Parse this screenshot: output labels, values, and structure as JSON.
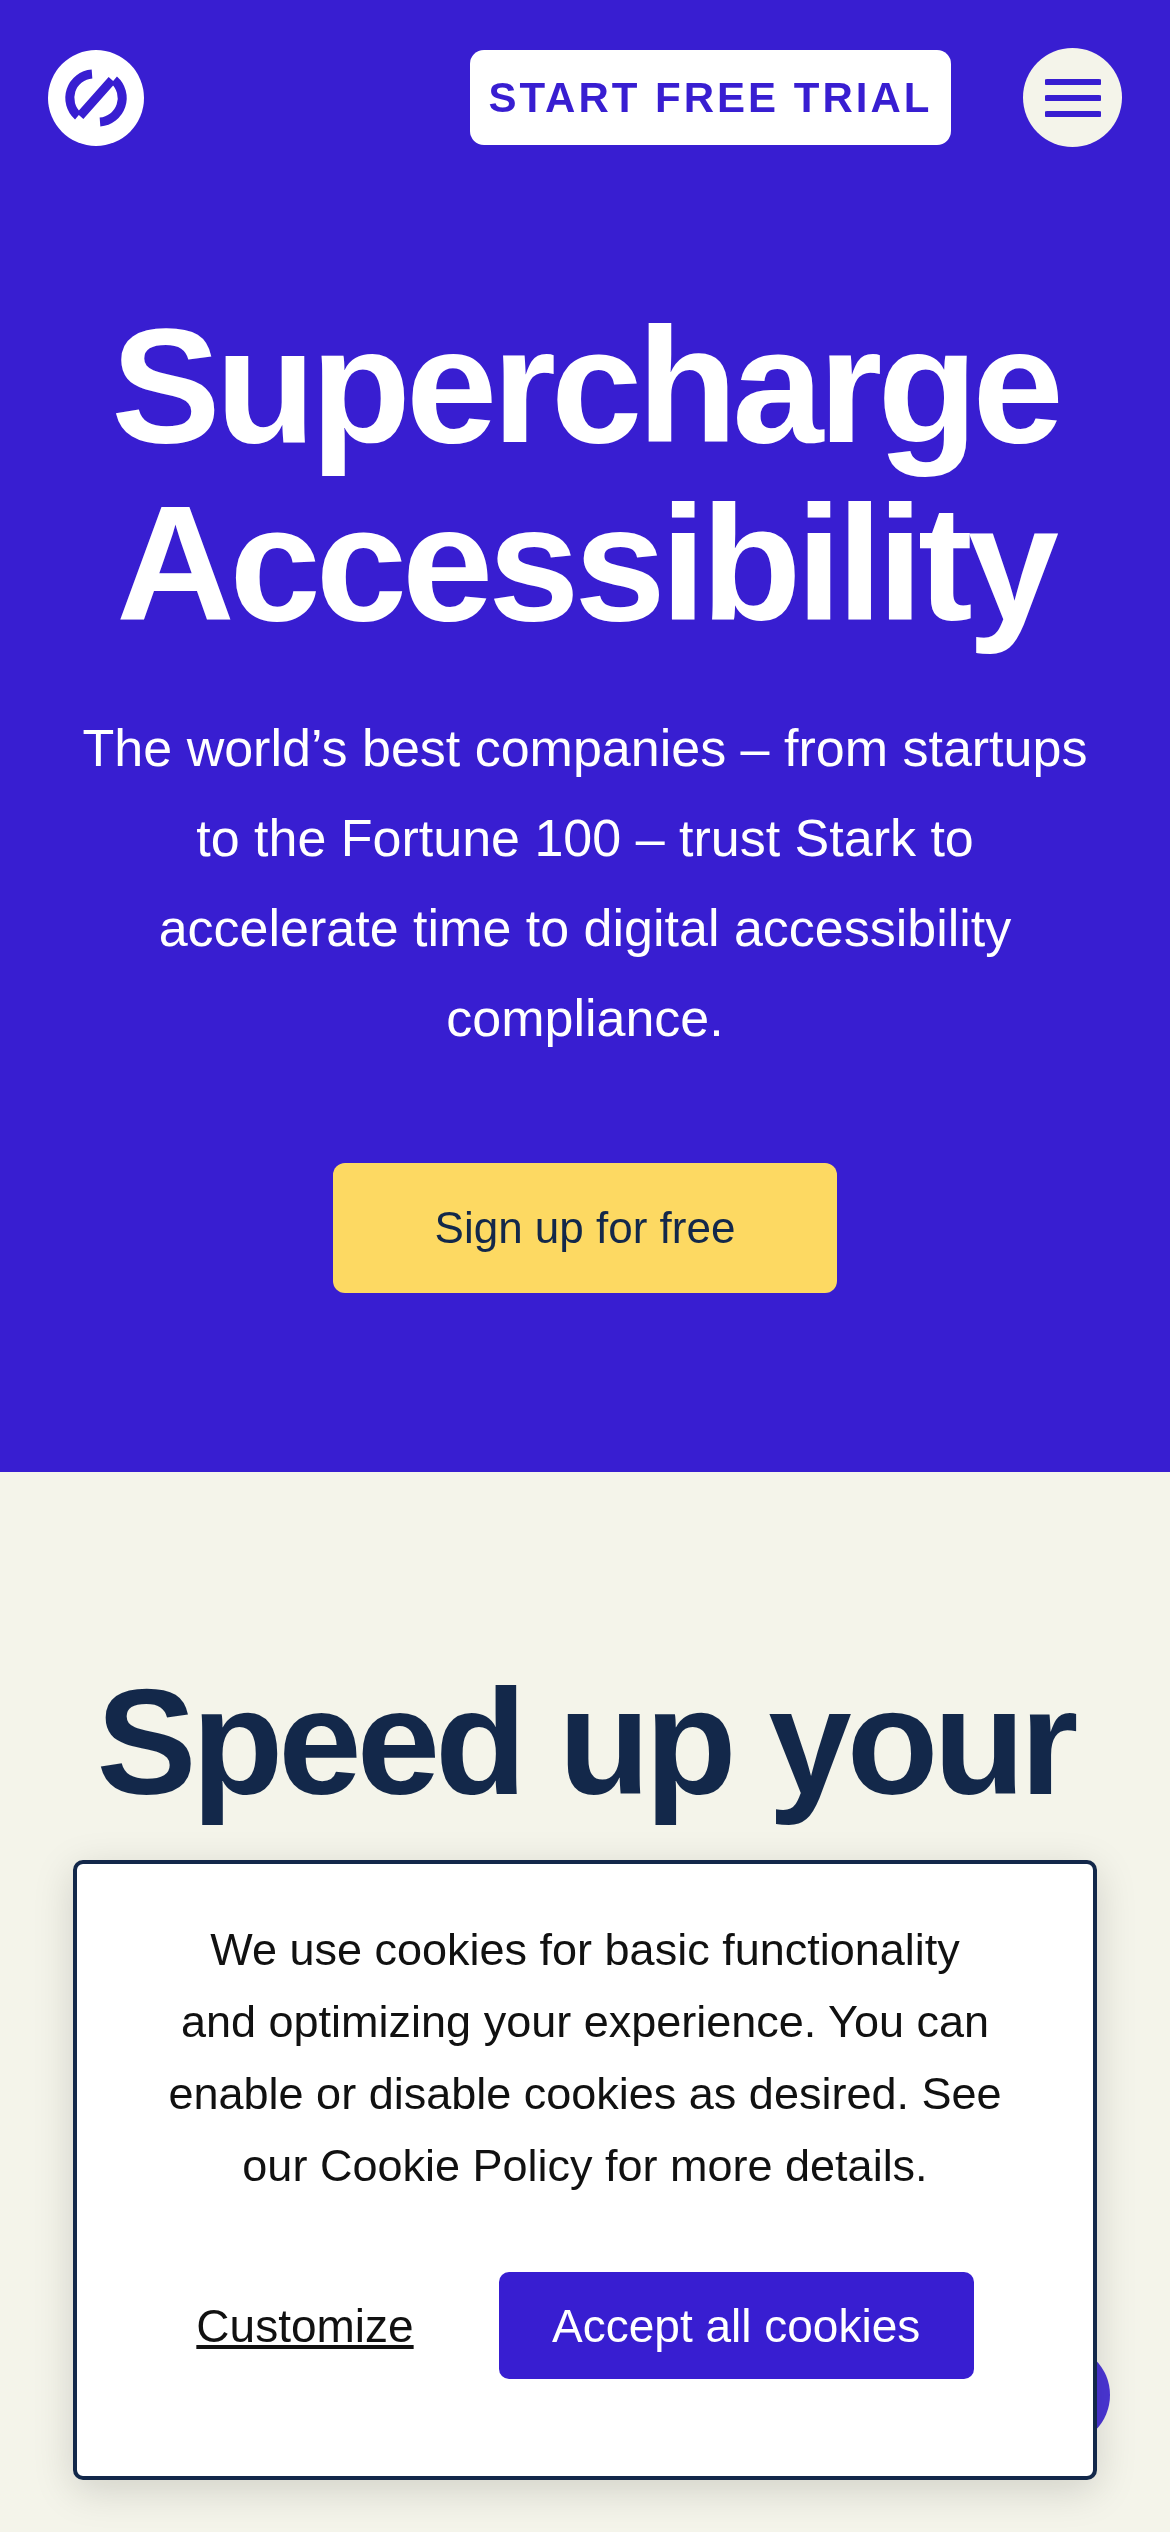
{
  "header": {
    "cta": "START FREE TRIAL"
  },
  "hero": {
    "title": "Supercharge Accessibility",
    "subtitle": "The world’s best companies – from startups to the Fortune 100 – trust Stark to accelerate time to digital accessibility compliance.",
    "button": "Sign up for free"
  },
  "section": {
    "heading": "Speed up your"
  },
  "cookie_banner": {
    "text": "We use cookies for basic functionality and optimizing your experience. You can enable or disable cookies as desired. See our Cookie Policy for more details.",
    "customize": "Customize",
    "accept": "Accept all cookies"
  }
}
